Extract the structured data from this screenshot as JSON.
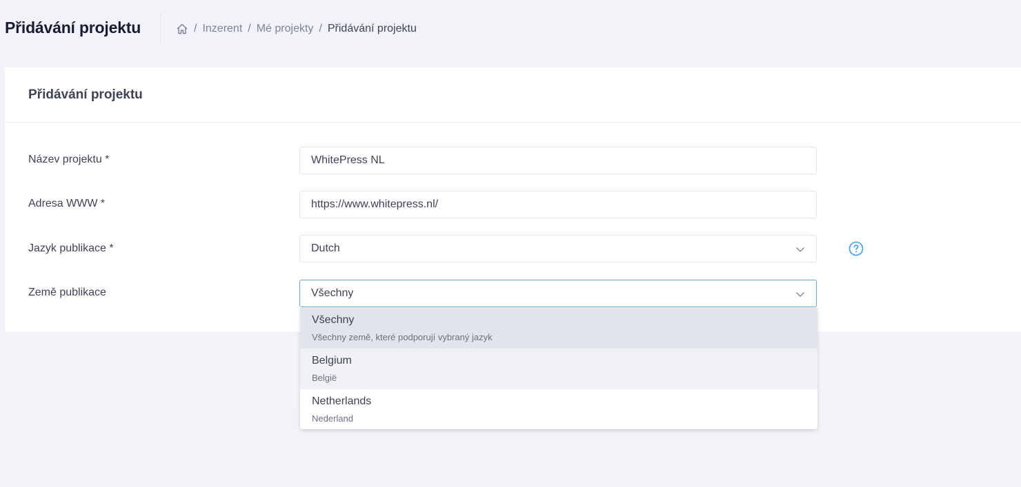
{
  "header": {
    "page_title": "Přidávání projektu",
    "breadcrumb": [
      "Inzerent",
      "Mé projekty",
      "Přidávání projektu"
    ]
  },
  "card": {
    "title": "Přidávání projektu"
  },
  "form": {
    "name_label": "Název projektu *",
    "name_value": "WhitePress NL",
    "url_label": "Adresa WWW *",
    "url_value": "https://www.whitepress.nl/",
    "language_label": "Jazyk publikace *",
    "language_value": "Dutch",
    "country_label": "Země publikace",
    "country_value": "Všechny"
  },
  "dropdown": {
    "options": [
      {
        "label": "Všechny",
        "sub": "Všechny země, které podporují vybraný jazyk"
      },
      {
        "label": "Belgium",
        "sub": "België"
      },
      {
        "label": "Netherlands",
        "sub": "Nederland"
      }
    ]
  },
  "colors": {
    "accent": "#3699ff",
    "focus_border": "#69a7e3",
    "background": "#f2f3f8"
  }
}
